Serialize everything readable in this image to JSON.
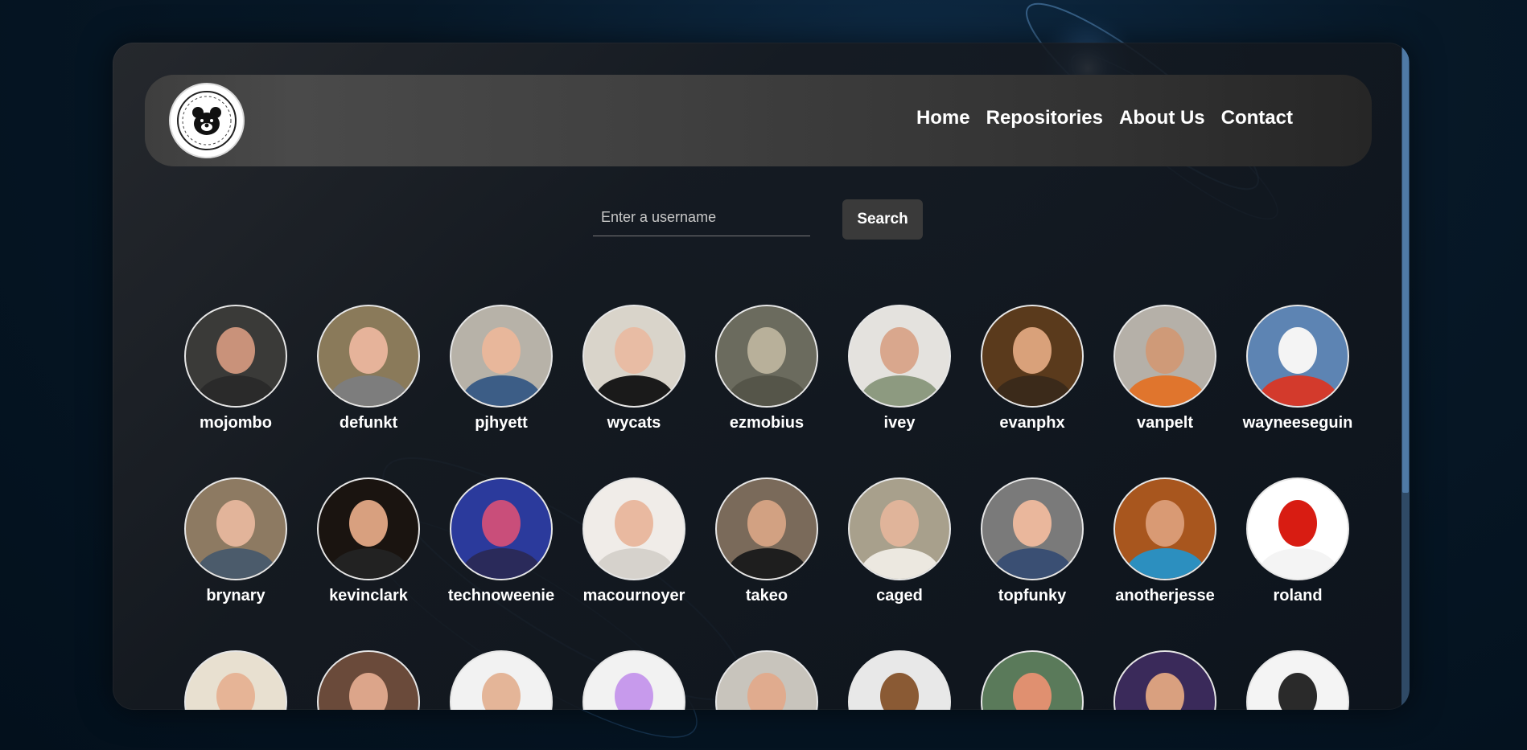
{
  "nav": {
    "logo_icon": "bear-logo-icon",
    "links": [
      "Home",
      "Repositories",
      "About Us",
      "Contact"
    ]
  },
  "search": {
    "placeholder": "Enter a username",
    "button_label": "Search"
  },
  "users": [
    {
      "name": "mojombo",
      "bg": "#3a3a38",
      "skin": "#c9927a",
      "shirt": "#2a2a2a"
    },
    {
      "name": "defunkt",
      "bg": "#8a7a5a",
      "skin": "#e6b39a",
      "shirt": "#7d7d7d"
    },
    {
      "name": "pjhyett",
      "bg": "#b7b2a8",
      "skin": "#e8b79b",
      "shirt": "#3c5d86"
    },
    {
      "name": "wycats",
      "bg": "#d9d4ca",
      "skin": "#e8bca4",
      "shirt": "#1a1a1a"
    },
    {
      "name": "ezmobius",
      "bg": "#6b6b5e",
      "skin": "#b8b09a",
      "shirt": "#555549"
    },
    {
      "name": "ivey",
      "bg": "#e4e2de",
      "skin": "#d9a78d",
      "shirt": "#8d9a80"
    },
    {
      "name": "evanphx",
      "bg": "#5a3a1c",
      "skin": "#d9a17a",
      "shirt": "#3b2a1a"
    },
    {
      "name": "vanpelt",
      "bg": "#b5b0a8",
      "skin": "#cf9a78",
      "shirt": "#e0752d"
    },
    {
      "name": "wayneeseguin",
      "bg": "#5d84b3",
      "skin": "#f4f4f4",
      "shirt": "#d33a2c"
    },
    {
      "name": "brynary",
      "bg": "#8d7a62",
      "skin": "#e2b49a",
      "shirt": "#4b5b6b"
    },
    {
      "name": "kevinclark",
      "bg": "#1a1410",
      "skin": "#d8a07f",
      "shirt": "#222222"
    },
    {
      "name": "technoweenie",
      "bg": "#2b3a9c",
      "skin": "#c94e7a",
      "shirt": "#2a2a5a"
    },
    {
      "name": "macournoyer",
      "bg": "#f0ece8",
      "skin": "#e9b9a0",
      "shirt": "#d6d2cc"
    },
    {
      "name": "takeo",
      "bg": "#7a6a5a",
      "skin": "#d2a182",
      "shirt": "#1e1e1e"
    },
    {
      "name": "caged",
      "bg": "#a8a08c",
      "skin": "#e0b49a",
      "shirt": "#ece8e0"
    },
    {
      "name": "topfunky",
      "bg": "#7a7a7a",
      "skin": "#eab79c",
      "shirt": "#3a4f73"
    },
    {
      "name": "anotherjesse",
      "bg": "#a8561e",
      "skin": "#d99a74",
      "shirt": "#2c8fbf"
    },
    {
      "name": "roland",
      "bg": "#ffffff",
      "skin": "#d81c12",
      "shirt": "#f4f4f4"
    },
    {
      "name": "",
      "bg": "#e8e0d0",
      "skin": "#e6b496",
      "shirt": "#5a4a3a"
    },
    {
      "name": "",
      "bg": "#6a4a3a",
      "skin": "#dca58a",
      "shirt": "#3a3a3a"
    },
    {
      "name": "",
      "bg": "#f2f2f2",
      "skin": "#e4b598",
      "shirt": "#9a9a9a"
    },
    {
      "name": "",
      "bg": "#f2f2f2",
      "skin": "#c79aec",
      "shirt": "#c79aec"
    },
    {
      "name": "",
      "bg": "#c8c4bc",
      "skin": "#e0ab8e",
      "shirt": "#4a4a4a"
    },
    {
      "name": "",
      "bg": "#e8e8e8",
      "skin": "#8a5a34",
      "shirt": "#6a4428"
    },
    {
      "name": "",
      "bg": "#5a7a5a",
      "skin": "#e09070",
      "shirt": "#6a8a6a"
    },
    {
      "name": "",
      "bg": "#3a2a5a",
      "skin": "#d9a07f",
      "shirt": "#c02a8a"
    },
    {
      "name": "",
      "bg": "#f4f4f4",
      "skin": "#2a2a2a",
      "shirt": "#d0d0d0"
    }
  ]
}
